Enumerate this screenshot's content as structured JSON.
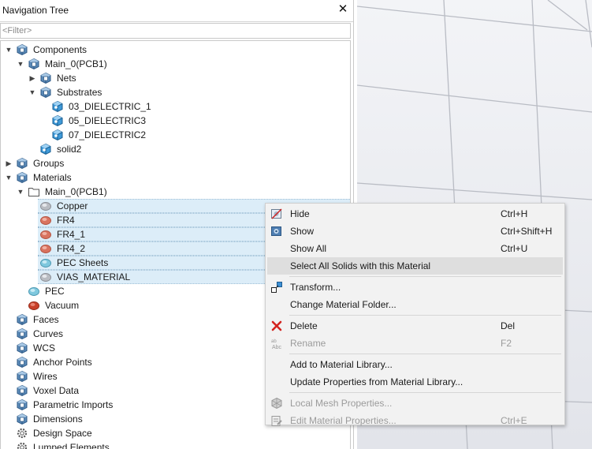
{
  "panel": {
    "title": "Navigation Tree",
    "close_symbol": "✕",
    "filter_placeholder": "<Filter>"
  },
  "tree": [
    {
      "label": "Components",
      "icon": "cube-icon",
      "toggle": "expanded",
      "selected": false
    },
    {
      "label": "Main_0(PCB1)",
      "icon": "cube-icon",
      "toggle": "expanded",
      "selected": false
    },
    {
      "label": "Nets",
      "icon": "cube-icon",
      "toggle": "collapsed",
      "selected": false
    },
    {
      "label": "Substrates",
      "icon": "cube-icon",
      "toggle": "expanded",
      "selected": false
    },
    {
      "label": "03_DIELECTRIC_1",
      "icon": "solid-icon",
      "toggle": "none",
      "selected": false
    },
    {
      "label": "05_DIELECTRIC3",
      "icon": "solid-icon",
      "toggle": "none",
      "selected": false
    },
    {
      "label": "07_DIELECTRIC2",
      "icon": "solid-icon",
      "toggle": "none",
      "selected": false
    },
    {
      "label": "solid2",
      "icon": "solid-icon",
      "toggle": "none",
      "selected": false
    },
    {
      "label": "Groups",
      "icon": "cube-icon",
      "toggle": "collapsed",
      "selected": false
    },
    {
      "label": "Materials",
      "icon": "cube-icon",
      "toggle": "expanded",
      "selected": false
    },
    {
      "label": "Main_0(PCB1)",
      "icon": "folder-icon",
      "toggle": "expanded",
      "selected": false
    },
    {
      "label": "Copper",
      "icon": "material-copper-icon",
      "toggle": "none",
      "selected": true
    },
    {
      "label": "FR4",
      "icon": "material-fr4-icon",
      "toggle": "none",
      "selected": true
    },
    {
      "label": "FR4_1",
      "icon": "material-fr4-icon",
      "toggle": "none",
      "selected": true
    },
    {
      "label": "FR4_2",
      "icon": "material-fr4-icon",
      "toggle": "none",
      "selected": true
    },
    {
      "label": "PEC Sheets",
      "icon": "material-pec-sheet-icon",
      "toggle": "none",
      "selected": true
    },
    {
      "label": "VIAS_MATERIAL",
      "icon": "material-copper-icon",
      "toggle": "none",
      "selected": true
    },
    {
      "label": "PEC",
      "icon": "material-pec-sheet-icon",
      "toggle": "none",
      "selected": false
    },
    {
      "label": "Vacuum",
      "icon": "material-vacuum-icon",
      "toggle": "none",
      "selected": false
    },
    {
      "label": "Faces",
      "icon": "cube-icon",
      "toggle": "none",
      "selected": false
    },
    {
      "label": "Curves",
      "icon": "cube-icon",
      "toggle": "none",
      "selected": false
    },
    {
      "label": "WCS",
      "icon": "cube-icon",
      "toggle": "none",
      "selected": false
    },
    {
      "label": "Anchor Points",
      "icon": "cube-icon",
      "toggle": "none",
      "selected": false
    },
    {
      "label": "Wires",
      "icon": "cube-icon",
      "toggle": "none",
      "selected": false
    },
    {
      "label": "Voxel Data",
      "icon": "cube-icon",
      "toggle": "none",
      "selected": false
    },
    {
      "label": "Parametric Imports",
      "icon": "cube-icon",
      "toggle": "none",
      "selected": false
    },
    {
      "label": "Dimensions",
      "icon": "cube-icon",
      "toggle": "none",
      "selected": false
    },
    {
      "label": "Design Space",
      "icon": "gear-icon",
      "toggle": "none",
      "selected": false
    },
    {
      "label": "Lumped Elements",
      "icon": "gear-icon",
      "toggle": "none",
      "selected": false
    }
  ],
  "context_menu": {
    "items": [
      {
        "label": "Hide",
        "shortcut": "Ctrl+H",
        "icon": "hide-icon",
        "disabled": false,
        "hover": false
      },
      {
        "label": "Show",
        "shortcut": "Ctrl+Shift+H",
        "icon": "show-icon",
        "disabled": false,
        "hover": false
      },
      {
        "label": "Show All",
        "shortcut": "Ctrl+U",
        "icon": "",
        "disabled": false,
        "hover": false
      },
      {
        "label": "Select All Solids with this Material",
        "shortcut": "",
        "icon": "",
        "disabled": false,
        "hover": true
      },
      {
        "separator": true
      },
      {
        "label": "Transform...",
        "shortcut": "",
        "icon": "transform-icon",
        "disabled": false,
        "hover": false
      },
      {
        "label": "Change Material Folder...",
        "shortcut": "",
        "icon": "",
        "disabled": false,
        "hover": false
      },
      {
        "separator": true
      },
      {
        "label": "Delete",
        "shortcut": "Del",
        "icon": "delete-icon",
        "disabled": false,
        "hover": false
      },
      {
        "label": "Rename",
        "shortcut": "F2",
        "icon": "rename-icon",
        "disabled": true,
        "hover": false
      },
      {
        "separator": true
      },
      {
        "label": "Add to Material Library...",
        "shortcut": "",
        "icon": "",
        "disabled": false,
        "hover": false
      },
      {
        "label": "Update Properties from Material Library...",
        "shortcut": "",
        "icon": "",
        "disabled": false,
        "hover": false
      },
      {
        "separator": true
      },
      {
        "label": "Local Mesh Properties...",
        "shortcut": "",
        "icon": "mesh-icon",
        "disabled": true,
        "hover": false
      },
      {
        "label": "Edit Material Properties...",
        "shortcut": "Ctrl+E",
        "icon": "edit-properties-icon",
        "disabled": true,
        "hover": false
      }
    ]
  }
}
